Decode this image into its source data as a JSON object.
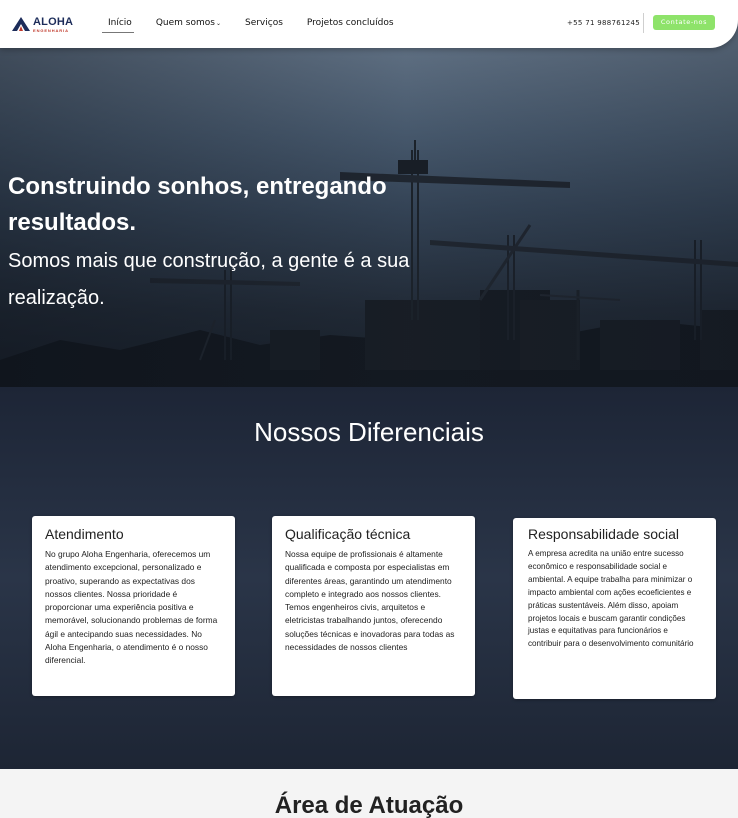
{
  "brand": {
    "name": "ALOHA",
    "subtitle": "ENGENHARIA",
    "logo_icon": "triangle-a-logo"
  },
  "nav": {
    "items": [
      {
        "label": "Início"
      },
      {
        "label": "Quem somos",
        "chevron": "⌄"
      },
      {
        "label": "Serviços"
      },
      {
        "label": "Projetos concluídos"
      }
    ]
  },
  "header": {
    "phone": "+55 71 988761245",
    "cta_label": "Contate-nos",
    "cta_color": "#8ee36a"
  },
  "hero": {
    "title": "Construindo sonhos, entregando resultados.",
    "subtitle": "Somos mais que construção, a gente é a sua realização."
  },
  "differentials": {
    "title_light": "Nossos ",
    "title_strong": "Diferenciais",
    "cards": [
      {
        "title": "Atendimento",
        "text": "No grupo Aloha Engenharia, oferecemos um atendimento excepcional, personalizado e proativo, superando as expectativas dos nossos clientes. Nossa prioridade é proporcionar uma experiência positiva e memorável, solucionando problemas de forma ágil e antecipando suas necessidades. No Aloha Engenharia, o atendimento é o nosso diferencial."
      },
      {
        "title": "Qualificação técnica",
        "text": "Nossa equipe de profissionais é altamente qualificada e composta por especialistas em diferentes áreas, garantindo um atendimento completo e integrado aos nossos clientes. Temos engenheiros civis, arquitetos e eletricistas trabalhando juntos, oferecendo soluções técnicas e inovadoras para todas as necessidades de nossos clientes"
      },
      {
        "title": "Responsabilidade social",
        "text": "A empresa acredita na união entre sucesso econômico e responsabilidade social e ambiental. A equipe trabalha para minimizar o impacto ambiental com ações ecoeficientes e práticas sustentáveis. Além disso, apoiam projetos locais e buscam garantir condições justas e equitativas para funcionários e contribuir para o desenvolvimento comunitário"
      }
    ]
  },
  "area": {
    "title": "Área de Atuação"
  }
}
